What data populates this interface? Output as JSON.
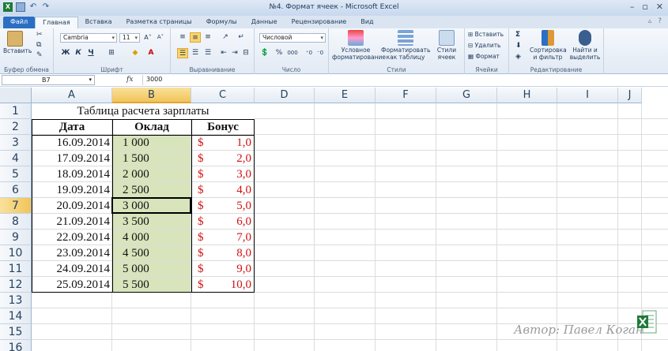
{
  "window": {
    "title": "№4. Формат ячеек  -  Microsoft Excel",
    "app_icon": "X"
  },
  "tabs": [
    "Файл",
    "Главная",
    "Вставка",
    "Разметка страницы",
    "Формулы",
    "Данные",
    "Рецензирование",
    "Вид"
  ],
  "ribbon": {
    "clipboard": {
      "paste": "Вставить",
      "label": "Буфер обмена"
    },
    "font": {
      "name": "Cambria",
      "size": "11",
      "bold": "Ж",
      "italic": "К",
      "underline": "Ч",
      "label": "Шрифт"
    },
    "alignment": {
      "label": "Выравнивание"
    },
    "number": {
      "format": "Числовой",
      "percent": "%",
      "thousands": "000",
      "label": "Число"
    },
    "styles": {
      "conditional": "Условное форматирование",
      "as_table": "Форматировать как таблицу",
      "cell_styles": "Стили ячеек",
      "label": "Стили"
    },
    "cells": {
      "insert": "Вставить",
      "delete": "Удалить",
      "format": "Формат",
      "label": "Ячейки"
    },
    "editing": {
      "sort": "Сортировка и фильтр",
      "find": "Найти и выделить",
      "label": "Редактирование"
    }
  },
  "formula_bar": {
    "name_box": "B7",
    "fx": "fx",
    "value": "3000"
  },
  "columns": [
    "A",
    "B",
    "C",
    "D",
    "E",
    "F",
    "G",
    "H",
    "I",
    "J"
  ],
  "selected_column": "B",
  "rows": [
    "1",
    "2",
    "3",
    "4",
    "5",
    "6",
    "7",
    "8",
    "9",
    "10",
    "11",
    "12",
    "13",
    "14",
    "15",
    "16"
  ],
  "selected_row": "7",
  "sheet": {
    "title": "Таблица расчета зарплаты",
    "headers": [
      "Дата",
      "Оклад",
      "Бонус"
    ],
    "currency": "$",
    "data": [
      {
        "date": "16.09.2014",
        "salary": "1 000",
        "bonus": "1,0"
      },
      {
        "date": "17.09.2014",
        "salary": "1 500",
        "bonus": "2,0"
      },
      {
        "date": "18.09.2014",
        "salary": "2 000",
        "bonus": "3,0"
      },
      {
        "date": "19.09.2014",
        "salary": "2 500",
        "bonus": "4,0"
      },
      {
        "date": "20.09.2014",
        "salary": "3 000",
        "bonus": "5,0"
      },
      {
        "date": "21.09.2014",
        "salary": "3 500",
        "bonus": "6,0"
      },
      {
        "date": "22.09.2014",
        "salary": "4 000",
        "bonus": "7,0"
      },
      {
        "date": "23.09.2014",
        "salary": "4 500",
        "bonus": "8,0"
      },
      {
        "date": "24.09.2014",
        "salary": "5 000",
        "bonus": "9,0"
      },
      {
        "date": "25.09.2014",
        "salary": "5 500",
        "bonus": "10,0"
      }
    ]
  },
  "watermark": "Автор: Павел Коган"
}
